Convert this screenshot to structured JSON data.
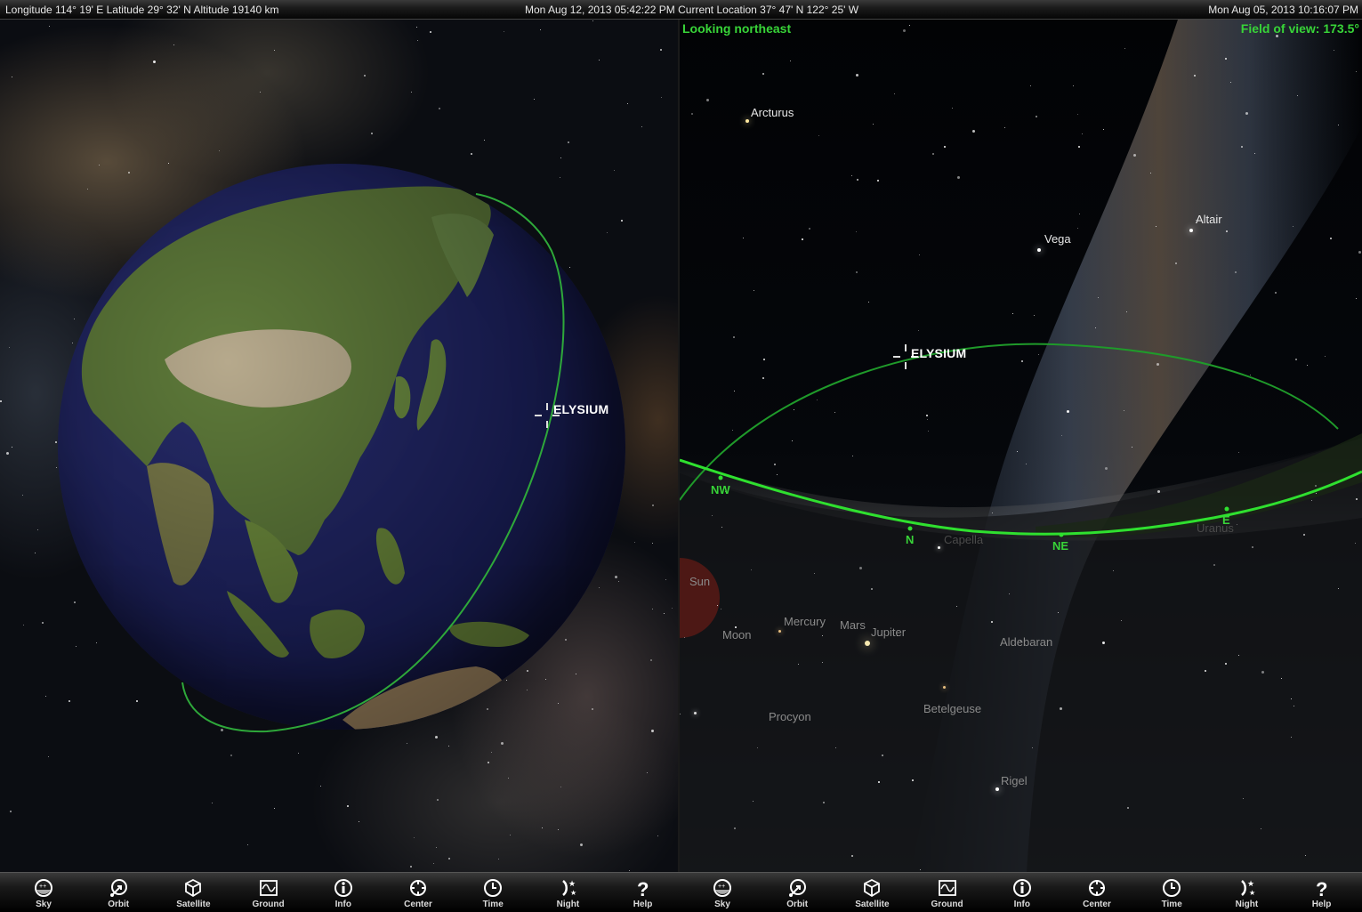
{
  "top_bar": {
    "left_coords": "Longitude 114° 19' E  Latitude 29° 32' N  Altitude 19140 km",
    "center_datetime_location": "Mon Aug 12, 2013  05:42:22 PM  Current Location  37° 47' N 122° 25' W",
    "right_datetime": "Mon Aug 05, 2013  10:16:07 PM"
  },
  "left_view": {
    "satellite_label": "ELYSIUM",
    "orbit_color": "#2ea83a",
    "ocean_color": "#1d2263"
  },
  "right_view": {
    "looking_direction": "Looking northeast",
    "field_of_view": "Field of view: 173.5°",
    "satellite_label": "ELYSIUM",
    "horizon_color": "#2fe02f",
    "compass": [
      "NW",
      "N",
      "NE",
      "E"
    ],
    "stars_above": [
      "Arcturus",
      "Vega",
      "Altair"
    ],
    "below_horizon_labels": [
      "Capella",
      "Uranus",
      "Sun",
      "Mercury",
      "Mars",
      "Jupiter",
      "Moon",
      "Aldebaran",
      "Procyon",
      "Betelgeuse",
      "Rigel"
    ]
  },
  "toolbar_left": [
    {
      "label": "Sky",
      "icon": "sky-icon"
    },
    {
      "label": "Orbit",
      "icon": "orbit-icon"
    },
    {
      "label": "Satellite",
      "icon": "satellite-cube-icon"
    },
    {
      "label": "Ground",
      "icon": "ground-track-icon"
    },
    {
      "label": "Info",
      "icon": "info-icon"
    },
    {
      "label": "Center",
      "icon": "crosshair-icon"
    },
    {
      "label": "Time",
      "icon": "clock-icon"
    },
    {
      "label": "Night",
      "icon": "moon-stars-icon"
    },
    {
      "label": "Help",
      "icon": "question-icon"
    }
  ],
  "toolbar_right": [
    {
      "label": "Sky",
      "icon": "sky-icon"
    },
    {
      "label": "Orbit",
      "icon": "orbit-icon"
    },
    {
      "label": "Satellite",
      "icon": "satellite-cube-icon"
    },
    {
      "label": "Ground",
      "icon": "ground-track-icon"
    },
    {
      "label": "Info",
      "icon": "info-icon"
    },
    {
      "label": "Center",
      "icon": "crosshair-icon"
    },
    {
      "label": "Time",
      "icon": "clock-icon"
    },
    {
      "label": "Night",
      "icon": "moon-stars-icon"
    },
    {
      "label": "Help",
      "icon": "question-icon"
    }
  ]
}
